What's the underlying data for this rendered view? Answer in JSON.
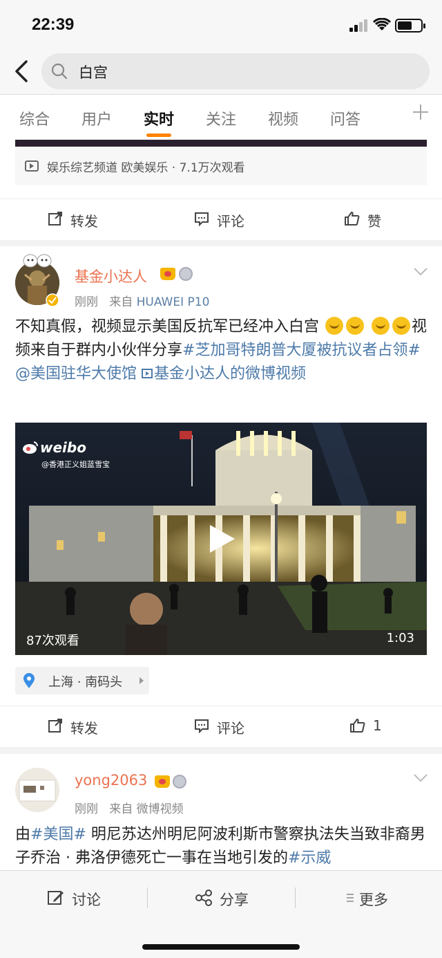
{
  "status_bar": {
    "time": "22:39"
  },
  "search": {
    "query": "白宫"
  },
  "tabs": [
    {
      "label": "综合"
    },
    {
      "label": "用户"
    },
    {
      "label": "实时"
    },
    {
      "label": "关注"
    },
    {
      "label": "视频"
    },
    {
      "label": "问答"
    }
  ],
  "prev_card": {
    "meta": "娱乐综艺频道 欧美娱乐 · 7.1万次观看",
    "actions": {
      "repost": "转发",
      "comment": "评论",
      "like": "赞"
    }
  },
  "post1": {
    "username": "基金小达人",
    "time": "刚刚",
    "from_label": "来自",
    "source": "HUAWEI P10",
    "text_plain": "不知真假，视频显示美国反抗军已经冲入白宫",
    "text_plain2": "视频来自于群内小伙伴分享",
    "hashtag": "#芝加哥特朗普大厦被抗议者占领#",
    "mention": "@美国驻华大使馆",
    "video_link": "基金小达人的微博视频",
    "video": {
      "watermark": "weibo",
      "watermark_sub": "@香港正义姐蓝雪宝",
      "views": "87次观看",
      "duration": "1:03"
    },
    "location": "上海 · 南码头",
    "actions": {
      "repost": "转发",
      "comment": "评论",
      "like": "1"
    }
  },
  "post2": {
    "username": "yong2063",
    "time": "刚刚",
    "from_label": "来自",
    "source": "微博视频",
    "text_prefix": "由",
    "hashtag1": "#美国#",
    "text_body": " 明尼苏达州明尼阿波利斯市警察执法失当致非裔男子乔治 · 弗洛伊德死亡一事在当地引发的",
    "hashtag2": "#示威"
  },
  "bottom_bar": {
    "discuss": "讨论",
    "share": "分享",
    "more": "更多"
  },
  "colors": {
    "accent": "#ff8200",
    "link": "#4d7aa9",
    "username": "#eb7350"
  }
}
